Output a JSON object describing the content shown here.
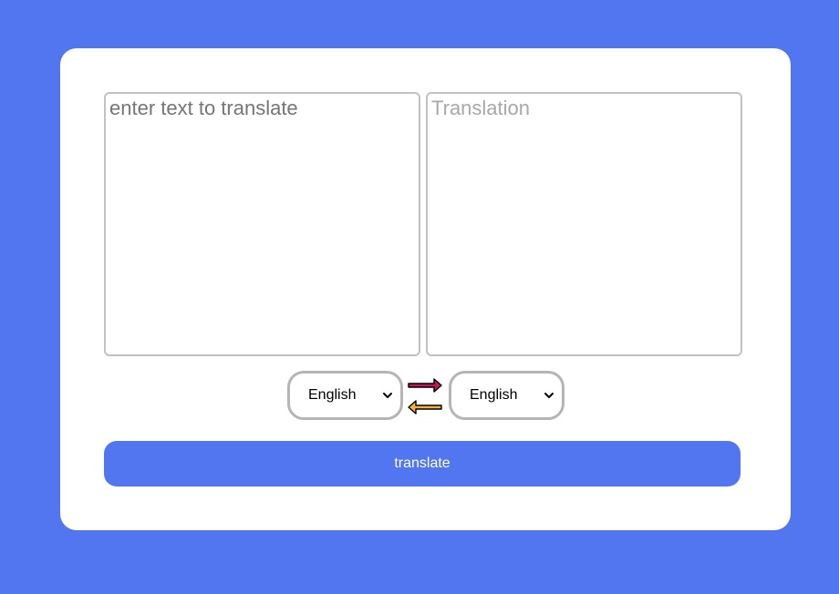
{
  "source_input": {
    "placeholder": "enter text to translate",
    "value": ""
  },
  "target_output": {
    "placeholder": "Translation",
    "value": ""
  },
  "language_controls": {
    "source_language": "English",
    "target_language": "English",
    "swap_icon": "swap-arrows-icon",
    "swap_colors": {
      "right_arrow": "#c2185b",
      "left_arrow": "#f7b040"
    }
  },
  "translate_button": {
    "label": "translate"
  },
  "colors": {
    "background": "#5275f0",
    "card": "#ffffff",
    "button": "#5275f0",
    "border": "#b5b5b5"
  }
}
